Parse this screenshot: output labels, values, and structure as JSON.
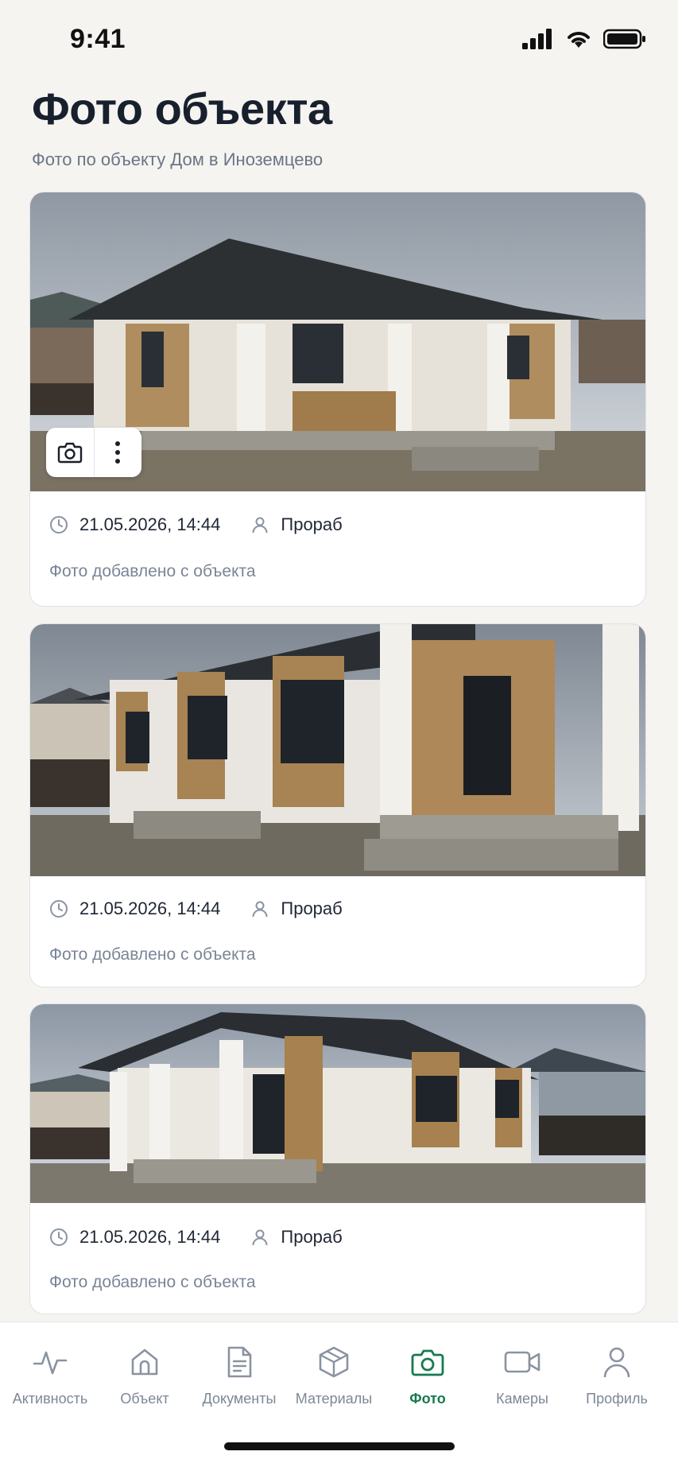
{
  "status_bar": {
    "time": "9:41"
  },
  "header": {
    "title": "Фото объекта",
    "subtitle": "Фото по объекту Дом в Иноземцево"
  },
  "photos": [
    {
      "date": "21.05.2026, 14:44",
      "author": "Прораб",
      "note": "Фото добавлено с объекта"
    },
    {
      "date": "21.05.2026, 14:44",
      "author": "Прораб",
      "note": "Фото добавлено с объекта"
    },
    {
      "date": "21.05.2026, 14:44",
      "author": "Прораб",
      "note": "Фото добавлено с объекта"
    }
  ],
  "tabs": [
    {
      "label": "Активность",
      "icon": "activity-icon",
      "active": false
    },
    {
      "label": "Объект",
      "icon": "house-icon",
      "active": false
    },
    {
      "label": "Документы",
      "icon": "document-icon",
      "active": false
    },
    {
      "label": "Материалы",
      "icon": "box-icon",
      "active": false
    },
    {
      "label": "Фото",
      "icon": "camera-icon",
      "active": true
    },
    {
      "label": "Камеры",
      "icon": "video-camera-icon",
      "active": false
    },
    {
      "label": "Профиль",
      "icon": "person-icon",
      "active": false
    }
  ],
  "colors": {
    "accent": "#167a4e",
    "inactive": "#7d8796",
    "background": "#f5f4f1"
  }
}
